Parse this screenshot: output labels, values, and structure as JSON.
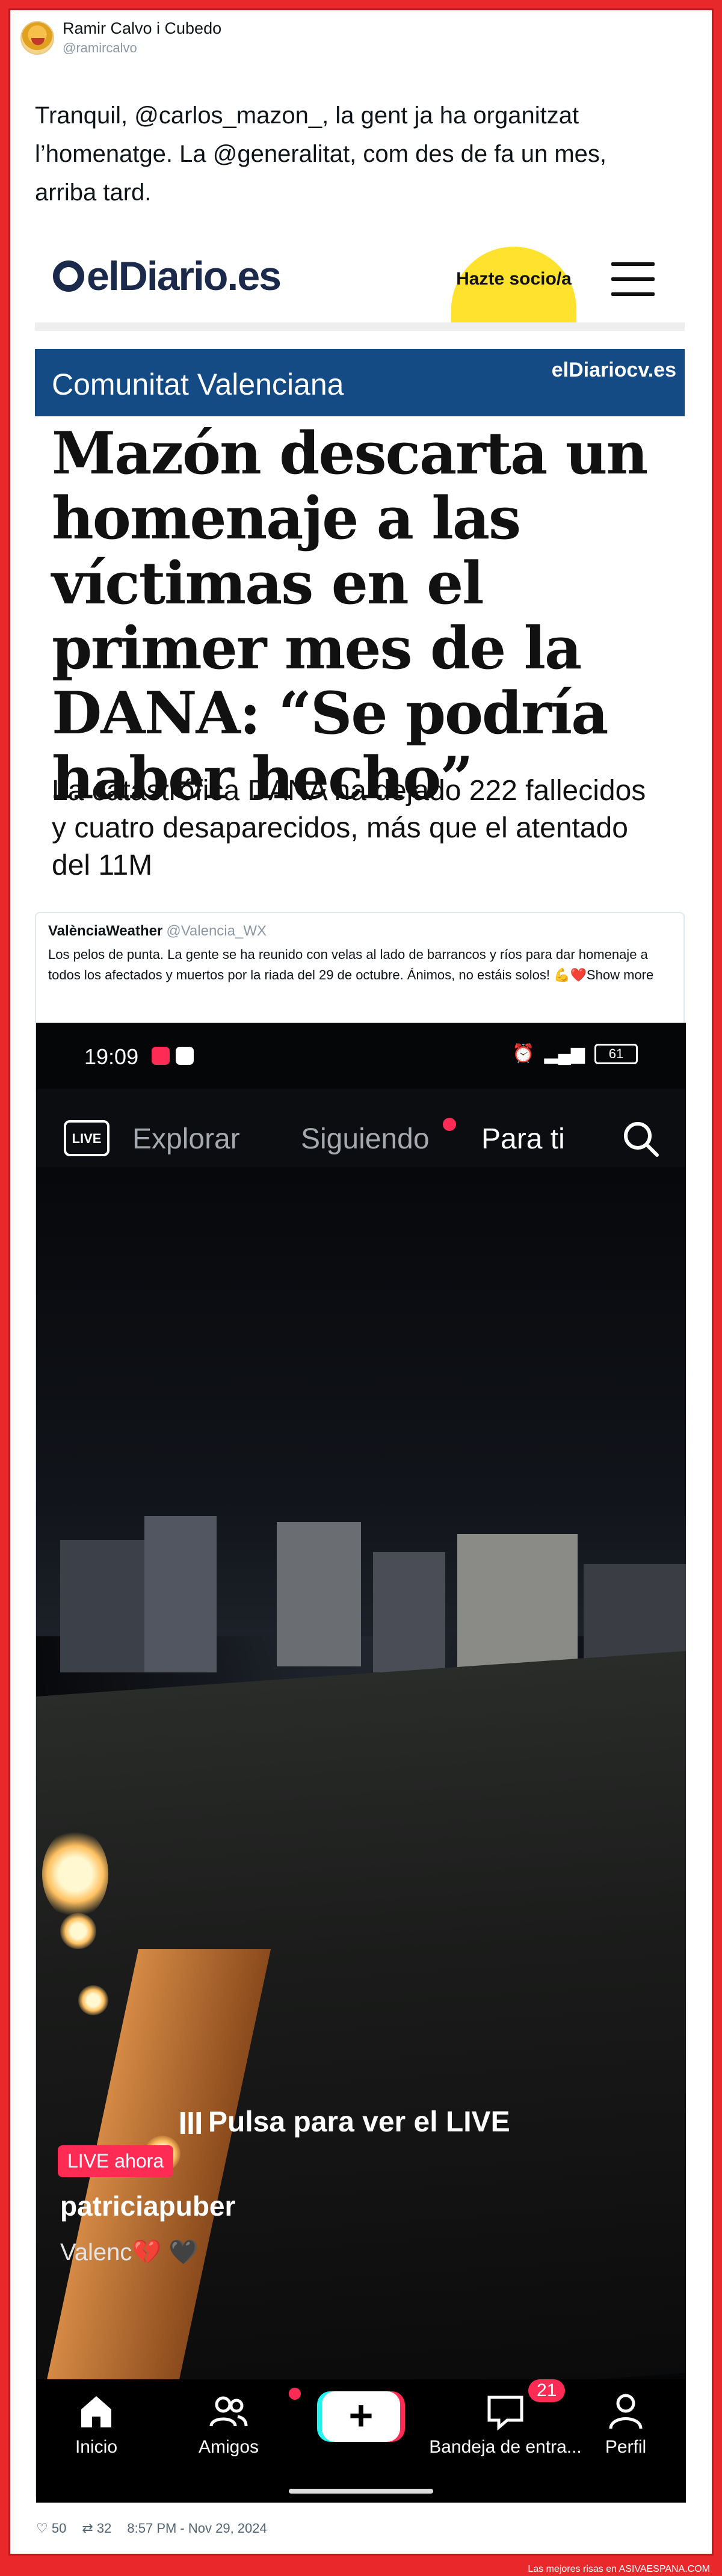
{
  "tweet": {
    "display_name": "Ramir Calvo i Cubedo",
    "handle": "@ramircalvo",
    "text": "Tranquil, @carlos_mazon_, la gent ja ha organitzat l’homenatge. La @generalitat, com des de fa un mes, arriba tard.",
    "likes": "50",
    "retweets": "32",
    "timestamp": "8:57 PM - Nov 29, 2024"
  },
  "eldiario": {
    "logo": "elDiario.es",
    "cta": "Hazte socio/a",
    "section": "Comunitat Valenciana",
    "section_brand": "elDiariocv.es",
    "headline": "Mazón descarta un homenaje a las víctimas en el primer mes de la DANA: “Se podría haber hecho”",
    "subhead": "La catastrófica DANA ha dejado 222 fallecidos y cuatro desaparecidos, más que el atentado del 11M"
  },
  "embedded": {
    "name": "ValènciaWeather",
    "handle": "@Valencia_WX",
    "text": "Los pelos de punta. La gente se ha reunido con velas al lado de barrancos y ríos para dar homenaje a todos los afectados y muertos por la riada del 29 de octubre. Ánimos, no estáis solos! 💪❤️",
    "show_more": "Show more"
  },
  "phone": {
    "time": "19:09",
    "battery": "61",
    "tabs": [
      "Explorar",
      "Siguiendo",
      "Para ti"
    ],
    "live_icon_label": "LIVE",
    "cta": "Pulsa para ver el LIVE",
    "live_now": "LIVE ahora",
    "username": "patriciapuber",
    "location": "Valenc💔 🖤",
    "bottom_nav": [
      "Inicio",
      "Amigos",
      "Bandeja de entra...",
      "Perfil"
    ],
    "inbox_badge": "21"
  },
  "watermark": "Las mejores risas en ASIVAESPANA.COM",
  "colors": {
    "frame": "#e8282b",
    "section_bg": "#144b84",
    "cta_bg": "#ffe22e",
    "tiktok_pink": "#fe2c55"
  }
}
